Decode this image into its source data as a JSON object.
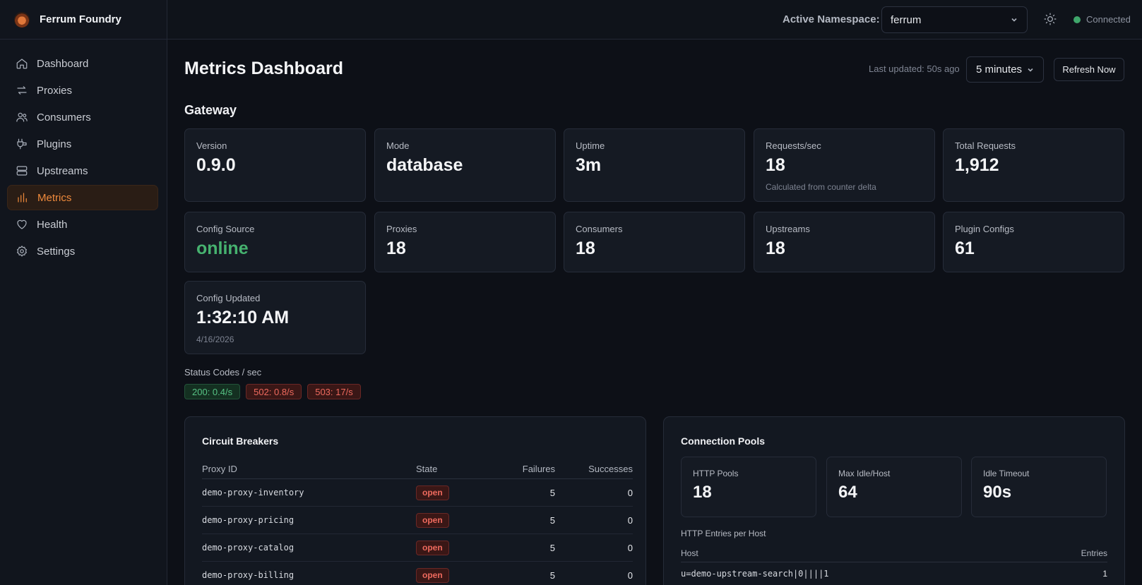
{
  "app": {
    "name": "Ferrum Foundry"
  },
  "sidebar": {
    "items": [
      {
        "label": "Dashboard",
        "icon": "home-icon",
        "active": false
      },
      {
        "label": "Proxies",
        "icon": "arrows-swap-icon",
        "active": false
      },
      {
        "label": "Consumers",
        "icon": "users-icon",
        "active": false
      },
      {
        "label": "Plugins",
        "icon": "plug-icon",
        "active": false
      },
      {
        "label": "Upstreams",
        "icon": "server-icon",
        "active": false
      },
      {
        "label": "Metrics",
        "icon": "bar-chart-icon",
        "active": true
      },
      {
        "label": "Health",
        "icon": "heart-icon",
        "active": false
      },
      {
        "label": "Settings",
        "icon": "gear-icon",
        "active": false
      }
    ]
  },
  "topbar": {
    "namespace_label": "Active Namespace:",
    "namespace_value": "ferrum",
    "connection_status": "Connected",
    "status_color": "#3fa66b"
  },
  "header": {
    "title": "Metrics Dashboard",
    "last_updated": "Last updated: 50s ago",
    "time_range": "5 minutes",
    "refresh_label": "Refresh Now"
  },
  "gateway": {
    "title": "Gateway",
    "cards": [
      {
        "label": "Version",
        "value": "0.9.0",
        "sub": ""
      },
      {
        "label": "Mode",
        "value": "database",
        "sub": ""
      },
      {
        "label": "Uptime",
        "value": "3m",
        "sub": ""
      },
      {
        "label": "Requests/sec",
        "value": "18",
        "sub": "Calculated from counter delta"
      },
      {
        "label": "Total Requests",
        "value": "1,912",
        "sub": ""
      },
      {
        "label": "Config Source",
        "value": "online",
        "sub": ""
      },
      {
        "label": "Proxies",
        "value": "18",
        "sub": ""
      },
      {
        "label": "Consumers",
        "value": "18",
        "sub": ""
      },
      {
        "label": "Upstreams",
        "value": "18",
        "sub": ""
      },
      {
        "label": "Plugin Configs",
        "value": "61",
        "sub": ""
      },
      {
        "label": "Config Updated",
        "value": "1:32:10 AM",
        "sub": "4/16/2026"
      }
    ],
    "status_codes_label": "Status Codes / sec",
    "status_codes": [
      {
        "text": "200: 0.4/s",
        "kind": "ok"
      },
      {
        "text": "502: 0.8/s",
        "kind": "err"
      },
      {
        "text": "503: 17/s",
        "kind": "err"
      }
    ]
  },
  "circuit_breakers": {
    "title": "Circuit Breakers",
    "columns": [
      "Proxy ID",
      "State",
      "Failures",
      "Successes"
    ],
    "rows": [
      {
        "id": "demo-proxy-inventory",
        "state": "open",
        "failures": "5",
        "successes": "0"
      },
      {
        "id": "demo-proxy-pricing",
        "state": "open",
        "failures": "5",
        "successes": "0"
      },
      {
        "id": "demo-proxy-catalog",
        "state": "open",
        "failures": "5",
        "successes": "0"
      },
      {
        "id": "demo-proxy-billing",
        "state": "open",
        "failures": "5",
        "successes": "0"
      }
    ]
  },
  "connection_pools": {
    "title": "Connection Pools",
    "cards": [
      {
        "label": "HTTP Pools",
        "value": "18"
      },
      {
        "label": "Max Idle/Host",
        "value": "64"
      },
      {
        "label": "Idle Timeout",
        "value": "90s"
      }
    ],
    "entries_label": "HTTP Entries per Host",
    "columns": [
      "Host",
      "Entries"
    ],
    "rows": [
      {
        "host": "u=demo-upstream-search|0||||1",
        "entries": "1"
      }
    ]
  }
}
